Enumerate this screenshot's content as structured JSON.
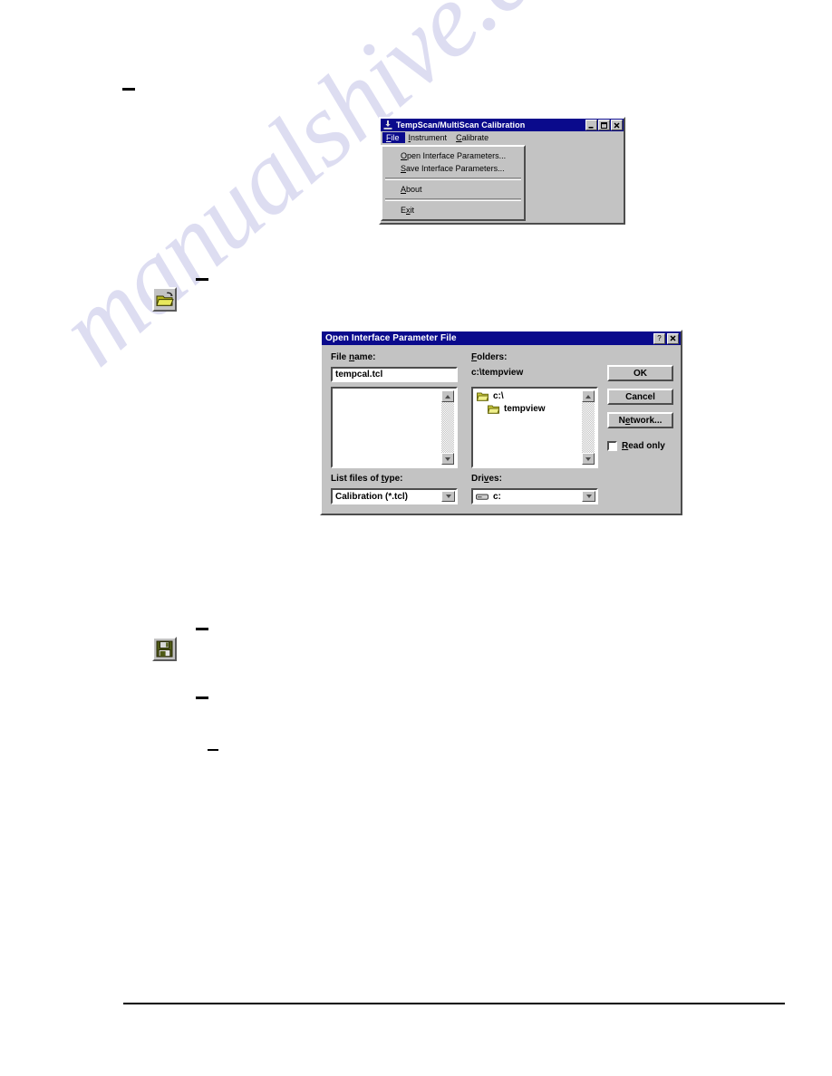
{
  "page": {
    "watermark": "manualshive.com",
    "redaction_marks": 5
  },
  "calibration_window": {
    "title": "TempScan/MultiScan Calibration",
    "title_icon": "app-icon",
    "window_buttons": {
      "minimize": "_",
      "maximize": "□",
      "close": "✕"
    },
    "menubar": [
      {
        "label": "File",
        "accel": "F",
        "active": true
      },
      {
        "label": "Instrument",
        "accel": "I",
        "active": false
      },
      {
        "label": "Calibrate",
        "accel": "C",
        "active": false
      }
    ],
    "file_menu": [
      {
        "label": "Open Interface Parameters...",
        "type": "item"
      },
      {
        "label": "Save Interface Parameters...",
        "type": "item"
      },
      {
        "type": "separator"
      },
      {
        "label": "About",
        "type": "item"
      },
      {
        "type": "separator"
      },
      {
        "label": "Exit",
        "type": "item"
      }
    ]
  },
  "open_dialog": {
    "title": "Open Interface Parameter File",
    "help_button": "?",
    "close_button": "✕",
    "file_name_label": "File name:",
    "file_name_value": "tempcal.tcl",
    "file_list": [],
    "list_files_label": "List files of type:",
    "list_files_value": "Calibration (*.tcl)",
    "folders_label": "Folders:",
    "current_path": "c:\\tempview",
    "folder_tree": [
      {
        "label": "c:\\",
        "depth": 0,
        "icon": "folder-open-icon"
      },
      {
        "label": "tempview",
        "depth": 1,
        "icon": "folder-icon"
      }
    ],
    "drives_label": "Drives:",
    "drives_value": "c:",
    "drive_icon": "drive-icon",
    "buttons": {
      "ok": "OK",
      "cancel": "Cancel",
      "network": "Network..."
    },
    "read_only_label": "Read only",
    "read_only_checked": false
  },
  "toolbar_icons": [
    {
      "name": "open-folder-icon",
      "tooltip": "Open Interface Parameters"
    },
    {
      "name": "save-floppy-icon",
      "tooltip": "Save Interface Parameters"
    }
  ],
  "colors": {
    "titlebar": "#0a0a8c",
    "face": "#c3c3c3",
    "watermark": "#c9c9ea"
  }
}
